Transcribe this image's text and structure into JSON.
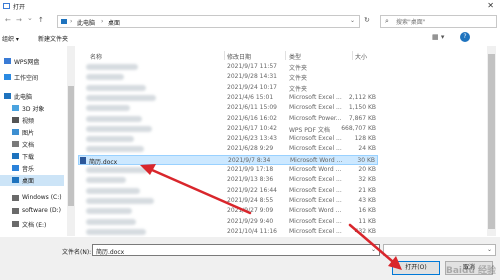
{
  "window": {
    "title": "打开",
    "close_glyph": "✕"
  },
  "nav": {
    "back": "←",
    "forward": "→",
    "up_caret": "⌄",
    "up": "↑",
    "breadcrumb": [
      "此电脑",
      "桌面"
    ],
    "breadcrumb_sep": "›",
    "refresh": "↻",
    "search_placeholder": "搜索\"桌面\""
  },
  "toolbar": {
    "organize": "组织 ▾",
    "new_folder": "新建文件夹",
    "view": "▦ ▾",
    "help": "?"
  },
  "sidebar": {
    "items": [
      {
        "label": "WPS网盘",
        "icon": "cloud-icon",
        "color": "#3a7bd5"
      },
      {
        "label": "工作空间",
        "icon": "workspace-icon",
        "color": "#2b8ae2"
      },
      {
        "label": "此电脑",
        "icon": "computer-icon",
        "color": "#1e73be"
      },
      {
        "label": "3D 对象",
        "icon": "cube-icon",
        "color": "#4aa3df"
      },
      {
        "label": "视频",
        "icon": "video-icon",
        "color": "#555555"
      },
      {
        "label": "图片",
        "icon": "picture-icon",
        "color": "#3d8fd1"
      },
      {
        "label": "文档",
        "icon": "document-icon",
        "color": "#7a7a7a"
      },
      {
        "label": "下载",
        "icon": "download-icon",
        "color": "#1e73be"
      },
      {
        "label": "音乐",
        "icon": "music-icon",
        "color": "#2a82da"
      },
      {
        "label": "桌面",
        "icon": "desktop-icon",
        "color": "#1e73be",
        "selected": true
      },
      {
        "label": "Windows (C:)",
        "icon": "drive-icon",
        "color": "#6a6a6a"
      },
      {
        "label": "software (D:)",
        "icon": "drive-icon",
        "color": "#6a6a6a"
      },
      {
        "label": "文档 (E:)",
        "icon": "drive-icon",
        "color": "#6a6a6a"
      }
    ]
  },
  "files": {
    "columns": [
      "名称",
      "修改日期",
      "类型",
      "大小"
    ],
    "rows": [
      {
        "name": "",
        "date": "2021/9/17 11:57",
        "type": "文件夹",
        "size": ""
      },
      {
        "name": "",
        "date": "2021/9/28 14:31",
        "type": "文件夹",
        "size": ""
      },
      {
        "name": "",
        "date": "2021/9/24 10:17",
        "type": "文件夹",
        "size": ""
      },
      {
        "name": "",
        "date": "2021/4/6 15:01",
        "type": "Microsoft Excel ...",
        "size": "2,112 KB"
      },
      {
        "name": "",
        "date": "2021/6/11 15:09",
        "type": "Microsoft Excel ...",
        "size": "1,150 KB"
      },
      {
        "name": "",
        "date": "2021/6/16 16:02",
        "type": "Microsoft Power...",
        "size": "7,867 KB"
      },
      {
        "name": "",
        "date": "2021/6/17 10:42",
        "type": "WPS PDF 文档",
        "size": "668,707 KB"
      },
      {
        "name": "",
        "date": "2021/6/23 13:43",
        "type": "Microsoft Excel ...",
        "size": "128 KB"
      },
      {
        "name": "",
        "date": "2021/6/28 9:29",
        "type": "Microsoft Excel ...",
        "size": "24 KB"
      },
      {
        "name": "简历.docx",
        "date": "2021/9/7 8:34",
        "type": "Microsoft Word ...",
        "size": "30 KB",
        "selected": true
      },
      {
        "name": "",
        "date": "2021/9/9 17:18",
        "type": "Microsoft Word ...",
        "size": "20 KB"
      },
      {
        "name": "",
        "date": "2021/9/13 8:36",
        "type": "Microsoft Excel ...",
        "size": "32 KB"
      },
      {
        "name": "",
        "date": "2021/9/22 16:44",
        "type": "Microsoft Excel ...",
        "size": "21 KB"
      },
      {
        "name": "",
        "date": "2021/9/24 8:55",
        "type": "Microsoft Excel ...",
        "size": "43 KB"
      },
      {
        "name": "",
        "date": "2021/9/27 9:09",
        "type": "Microsoft Word ...",
        "size": "16 KB"
      },
      {
        "name": "",
        "date": "2021/9/29 9:40",
        "type": "Microsoft Excel ...",
        "size": "11 KB"
      },
      {
        "name": "",
        "date": "2021/10/4 11:16",
        "type": "Microsoft Excel ...",
        "size": "432 KB"
      }
    ]
  },
  "bottom": {
    "filename_label": "文件名(N):",
    "filename_value": "简历.docx",
    "dropdown": "⌄",
    "open_label": "打开(O)",
    "cancel_label": "取消"
  },
  "annotation_color": "#d9262c",
  "watermark": "Baidu 经验"
}
